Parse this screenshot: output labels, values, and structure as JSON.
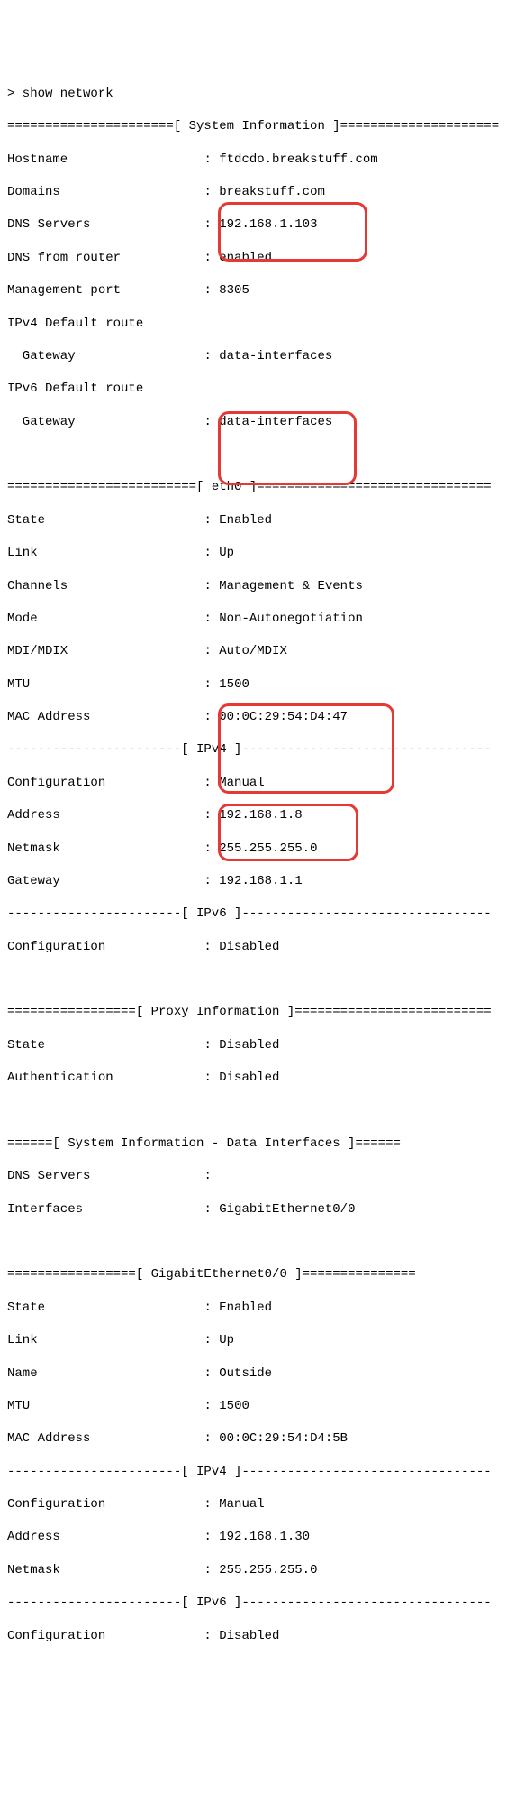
{
  "prompt": "> show network",
  "sections": {
    "sysinfo_header": "======================[ System Information ]=====================",
    "sysinfo": {
      "hostname_label": "Hostname",
      "hostname_value": "ftdcdo.breakstuff.com",
      "domains_label": "Domains",
      "domains_value": "breakstuff.com",
      "dns_servers_label": "DNS Servers",
      "dns_servers_value": "192.168.1.103",
      "dns_router_label": "DNS from router",
      "dns_router_value": "enabled",
      "mgmt_port_label": "Management port",
      "mgmt_port_value": "8305",
      "ipv4_route_label": "IPv4 Default route",
      "ipv4_gw_label": "  Gateway",
      "ipv4_gw_value": "data-interfaces",
      "ipv6_route_label": "IPv6 Default route",
      "ipv6_gw_label": "  Gateway",
      "ipv6_gw_value": "data-interfaces"
    },
    "eth0_header": "=========================[ eth0 ]===============================",
    "eth0": {
      "state_label": "State",
      "state_value": "Enabled",
      "link_label": "Link",
      "link_value": "Up",
      "channels_label": "Channels",
      "channels_value": "Management & Events",
      "mode_label": "Mode",
      "mode_value": "Non-Autonegotiation",
      "mdi_label": "MDI/MDIX",
      "mdi_value": "Auto/MDIX",
      "mtu_label": "MTU",
      "mtu_value": "1500",
      "mac_label": "MAC Address",
      "mac_value": "00:0C:29:54:D4:47"
    },
    "eth0_ipv4_header": "-----------------------[ IPv4 ]---------------------------------",
    "eth0_ipv4": {
      "config_label": "Configuration",
      "config_value": "Manual",
      "addr_label": "Address",
      "addr_value": "192.168.1.8",
      "netmask_label": "Netmask",
      "netmask_value": "255.255.255.0",
      "gateway_label": "Gateway",
      "gateway_value": "192.168.1.1"
    },
    "eth0_ipv6_header": "-----------------------[ IPv6 ]---------------------------------",
    "eth0_ipv6": {
      "config_label": "Configuration",
      "config_value": "Disabled"
    },
    "proxy_header": "=================[ Proxy Information ]==========================",
    "proxy": {
      "state_label": "State",
      "state_value": "Disabled",
      "auth_label": "Authentication",
      "auth_value": "Disabled"
    },
    "sysdata_header": "======[ System Information - Data Interfaces ]======",
    "sysdata": {
      "dns_label": "DNS Servers",
      "dns_value": "",
      "ifaces_label": "Interfaces",
      "ifaces_value": "GigabitEthernet0/0"
    },
    "gig_header": "=================[ GigabitEthernet0/0 ]===============",
    "gig": {
      "state_label": "State",
      "state_value": "Enabled",
      "link_label": "Link",
      "link_value": "Up",
      "name_label": "Name",
      "name_value": "Outside",
      "mtu_label": "MTU",
      "mtu_value": "1500",
      "mac_label": "MAC Address",
      "mac_value": "00:0C:29:54:D4:5B"
    },
    "gig_ipv4_header": "-----------------------[ IPv4 ]---------------------------------",
    "gig_ipv4": {
      "config_label": "Configuration",
      "config_value": "Manual",
      "addr_label": "Address",
      "addr_value": "192.168.1.30",
      "netmask_label": "Netmask",
      "netmask_value": "255.255.255.0"
    },
    "gig_ipv6_header": "-----------------------[ IPv6 ]---------------------------------",
    "gig_ipv6": {
      "config_label": "Configuration",
      "config_value": "Disabled"
    }
  }
}
